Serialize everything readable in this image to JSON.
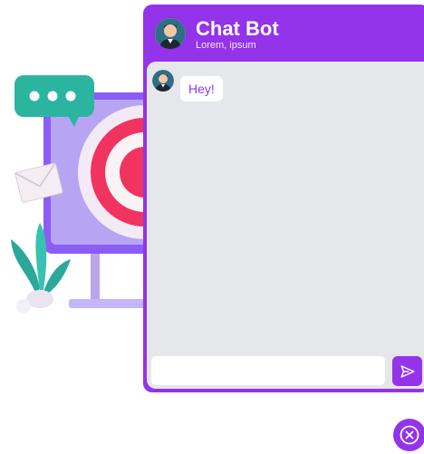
{
  "chat": {
    "title": "Chat Bot",
    "subtitle": "Lorem, ipsum",
    "messages": [
      {
        "sender": "bot",
        "text": "Hey!"
      }
    ],
    "input": {
      "value": "",
      "placeholder": ""
    }
  },
  "icons": {
    "header_avatar": "bot-avatar-icon",
    "message_avatar": "bot-avatar-icon",
    "send": "send-icon",
    "close": "close-icon",
    "illustration": [
      "speech-bubble-icon",
      "envelope-icon",
      "monitor-icon",
      "target-icon",
      "plant-icon"
    ]
  },
  "colors": {
    "accent": "#9333ea",
    "chat_background": "#e5e7eb",
    "message_text": "#9333ea",
    "header_text": "#ffffff"
  }
}
